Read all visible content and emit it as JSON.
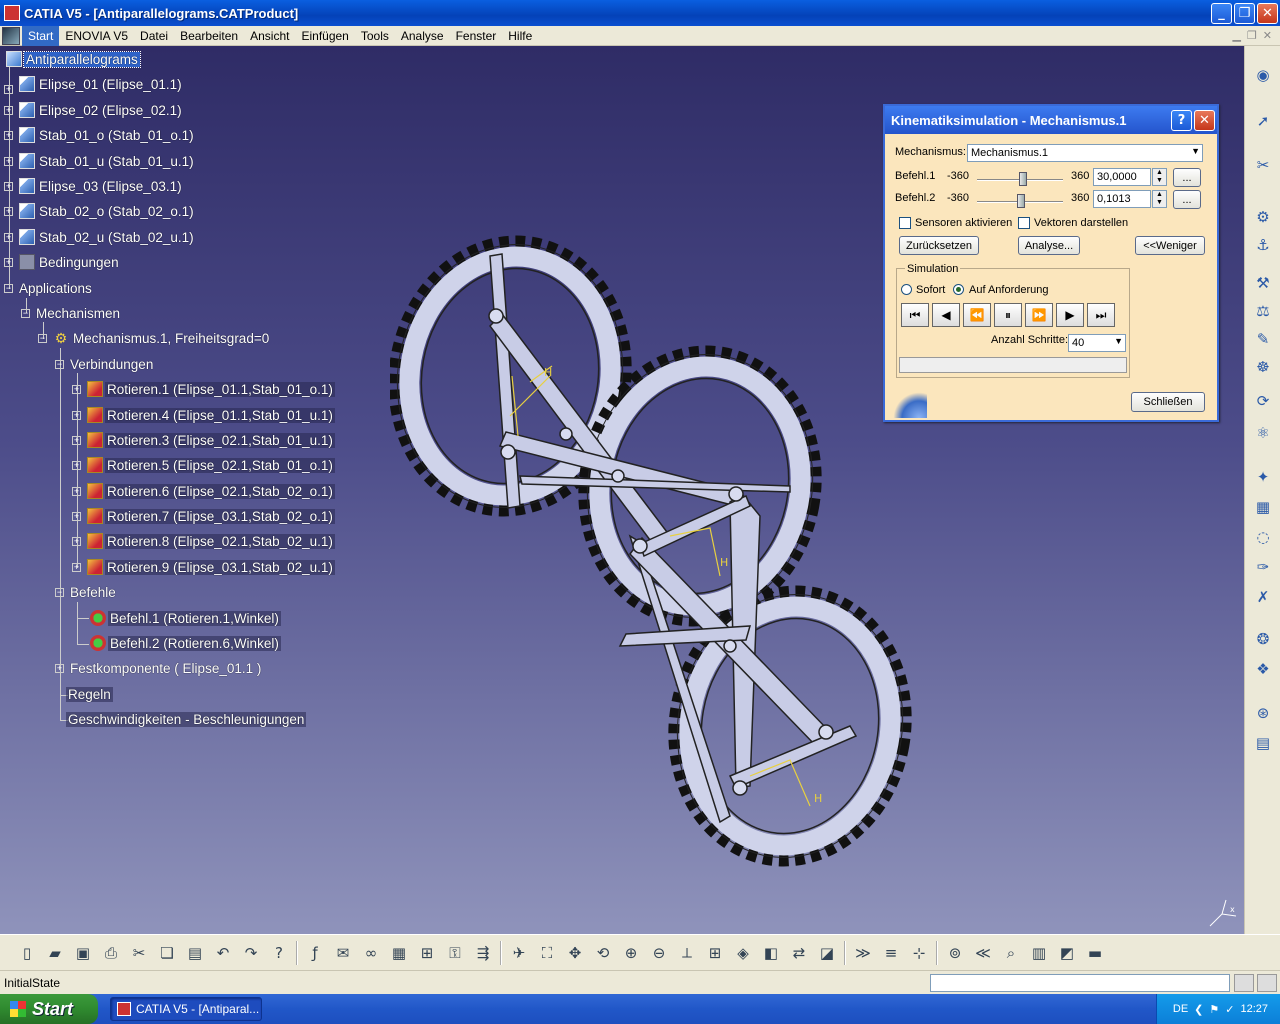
{
  "window": {
    "title": "CATIA V5 - [Antiparallelograms.CATProduct]"
  },
  "menu": {
    "items": [
      "Start",
      "ENOVIA V5",
      "Datei",
      "Bearbeiten",
      "Ansicht",
      "Einfügen",
      "Tools",
      "Analyse",
      "Fenster",
      "Hilfe"
    ]
  },
  "tree": {
    "root": "Antiparallelograms",
    "parts": [
      "Elipse_01 (Elipse_01.1)",
      "Elipse_02 (Elipse_02.1)",
      "Stab_01_o (Stab_01_o.1)",
      "Stab_01_u (Stab_01_u.1)",
      "Elipse_03 (Elipse_03.1)",
      "Stab_02_o (Stab_02_o.1)",
      "Stab_02_u (Stab_02_u.1)"
    ],
    "constraints": "Bedingungen",
    "applications": "Applications",
    "mechanisms": "Mechanismen",
    "mechanism": "Mechanismus.1, Freiheitsgrad=0",
    "joints_label": "Verbindungen",
    "joints": [
      "Rotieren.1 (Elipse_01.1,Stab_01_o.1)",
      "Rotieren.4 (Elipse_01.1,Stab_01_u.1)",
      "Rotieren.3 (Elipse_02.1,Stab_01_u.1)",
      "Rotieren.5 (Elipse_02.1,Stab_01_o.1)",
      "Rotieren.6 (Elipse_02.1,Stab_02_o.1)",
      "Rotieren.7 (Elipse_03.1,Stab_02_o.1)",
      "Rotieren.8 (Elipse_02.1,Stab_02_u.1)",
      "Rotieren.9 (Elipse_03.1,Stab_02_u.1)"
    ],
    "commands_label": "Befehle",
    "commands": [
      "Befehl.1 (Rotieren.1,Winkel)",
      "Befehl.2 (Rotieren.6,Winkel)"
    ],
    "fixed": "Festkomponente ( Elipse_01.1 )",
    "rules": "Regeln",
    "speeds": "Geschwindigkeiten - Beschleunigungen"
  },
  "dialog": {
    "title": "Kinematiksimulation - Mechanismus.1",
    "help": "?",
    "close_x": "✕",
    "mechanism_label": "Mechanismus:",
    "mechanism_value": "Mechanismus.1",
    "commands": [
      {
        "label": "Befehl.1",
        "min": "-360",
        "max": "360",
        "value": "30,0000"
      },
      {
        "label": "Befehl.2",
        "min": "-360",
        "max": "360",
        "value": "0,1013"
      }
    ],
    "more_btn": "...",
    "sensors_label": "Sensoren aktivieren",
    "vectors_label": "Vektoren darstellen",
    "reset_btn": "Zurücksetzen",
    "analysis_btn": "Analyse...",
    "less_btn": "<<Weniger",
    "simulation_label": "Simulation",
    "immediate_label": "Sofort",
    "ondemand_label": "Auf Anforderung",
    "steps_label": "Anzahl Schritte:",
    "steps_value": "40",
    "close_btn": "Schließen"
  },
  "status": {
    "text": "InitialState"
  },
  "taskbar": {
    "start": "Start",
    "app": "CATIA V5 - [Antiparal...",
    "lang": "DE",
    "time": "12:27"
  },
  "colors": {
    "viewport_top": "#2f2c66",
    "viewport_bottom": "#8f93bb",
    "dialog_bg": "#fbe6bd",
    "selection": "#2e62c8"
  },
  "icons": {
    "right_toolbar": [
      "compass-icon",
      "select-arrow-icon",
      "scissors-icon",
      "assembly-icon",
      "constraint-icon",
      "joint-icon",
      "mechanism-icon",
      "simulation-icon",
      "sensor-icon",
      "replay-icon",
      "analysis-icon",
      "clash-icon",
      "distance-icon",
      "sweep-icon",
      "trace-icon",
      "law-icon",
      "speed-icon",
      "revolve-icon",
      "fix-icon",
      "catalog-icon"
    ],
    "bottom_toolbar": [
      "new-icon",
      "open-icon",
      "save-icon",
      "print-icon",
      "cut-icon",
      "copy-icon",
      "paste-icon",
      "undo-icon",
      "redo-icon",
      "whats-this-icon",
      "formula-icon",
      "comment-icon",
      "link-icon",
      "table-icon",
      "tree-icon",
      "lock-icon",
      "param-icon",
      "fly-icon",
      "fit-all-icon",
      "pan-icon",
      "rotate-icon",
      "zoom-in-icon",
      "zoom-out-icon",
      "normal-view-icon",
      "multi-view-icon",
      "iso-view-icon",
      "hide-icon",
      "swap-icon",
      "render-icon",
      "measure-icon",
      "section-icon",
      "compass-icon",
      "prev-icon",
      "next-icon",
      "search-icon",
      "publish-icon",
      "color-icon",
      "layer-icon"
    ]
  }
}
